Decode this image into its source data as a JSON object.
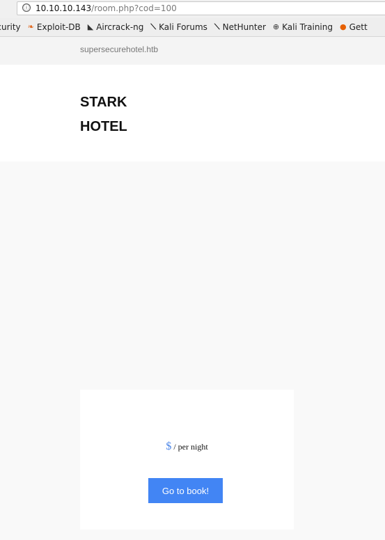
{
  "browser": {
    "url_host": "10.10.10.143",
    "url_path": "/room.php?cod=100",
    "info_icon": "ⓘ",
    "bookmarks": [
      {
        "label": "ecurity",
        "icon": "",
        "icon_name": "none",
        "color": "#222222"
      },
      {
        "label": "Exploit-DB",
        "icon": "❧",
        "icon_name": "exploit-db-icon",
        "color": "#e0681f"
      },
      {
        "label": "Aircrack-ng",
        "icon": "◣",
        "icon_name": "aircrack-icon",
        "color": "#333333"
      },
      {
        "label": "Kali Forums",
        "icon": "⟍",
        "icon_name": "kali-forums-icon",
        "color": "#111111"
      },
      {
        "label": "NetHunter",
        "icon": "⟍",
        "icon_name": "nethunter-icon",
        "color": "#111111"
      },
      {
        "label": "Kali Training",
        "icon": "⊕",
        "icon_name": "globe-icon",
        "color": "#333333"
      },
      {
        "label": "Gett",
        "icon": "●",
        "icon_name": "firefox-icon",
        "color": "#e66000"
      }
    ]
  },
  "page": {
    "site_host": "supersecurehotel.htb",
    "brand_line1": "STARK",
    "brand_line2": "HOTEL",
    "price": {
      "currency": "$",
      "suffix": " / per night"
    },
    "book_button": "Go to book!"
  },
  "colors": {
    "accent": "#4285f4",
    "background": "#f9f9f9"
  }
}
